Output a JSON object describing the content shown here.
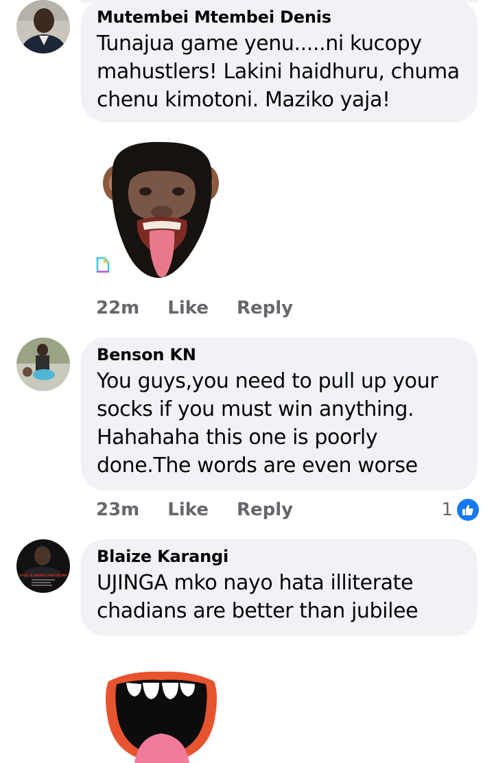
{
  "comments": [
    {
      "author": "Mutembei Mtembei Denis",
      "text": "Tunajua game yenu.....ni kucopy\nmahustlers! Lakini haidhuru, chuma\nchenu kimotoni. Maziko yaja!",
      "time": "22m",
      "like_label": "Like",
      "reply_label": "Reply",
      "sticker": "laughing-chimp-sticker"
    },
    {
      "author": "Benson KN",
      "text": "You guys,you need to pull up your\nsocks if you must win anything.\nHahahaha this one is poorly\ndone.The words are even worse",
      "time": "23m",
      "like_label": "Like",
      "reply_label": "Reply",
      "reaction_count": "1"
    },
    {
      "author": "Blaize Karangi",
      "text": "UJINGA mko nayo hata illiterate\nchadians are better than jubilee",
      "sticker": "laughing-mouth-sticker",
      "avatar_caption": "2021 IS ABOUT DISCIPLINE"
    }
  ],
  "colors": {
    "bubble": "#f0f2f5",
    "meta_text": "#65676b",
    "like_blue": "#1877f2"
  }
}
